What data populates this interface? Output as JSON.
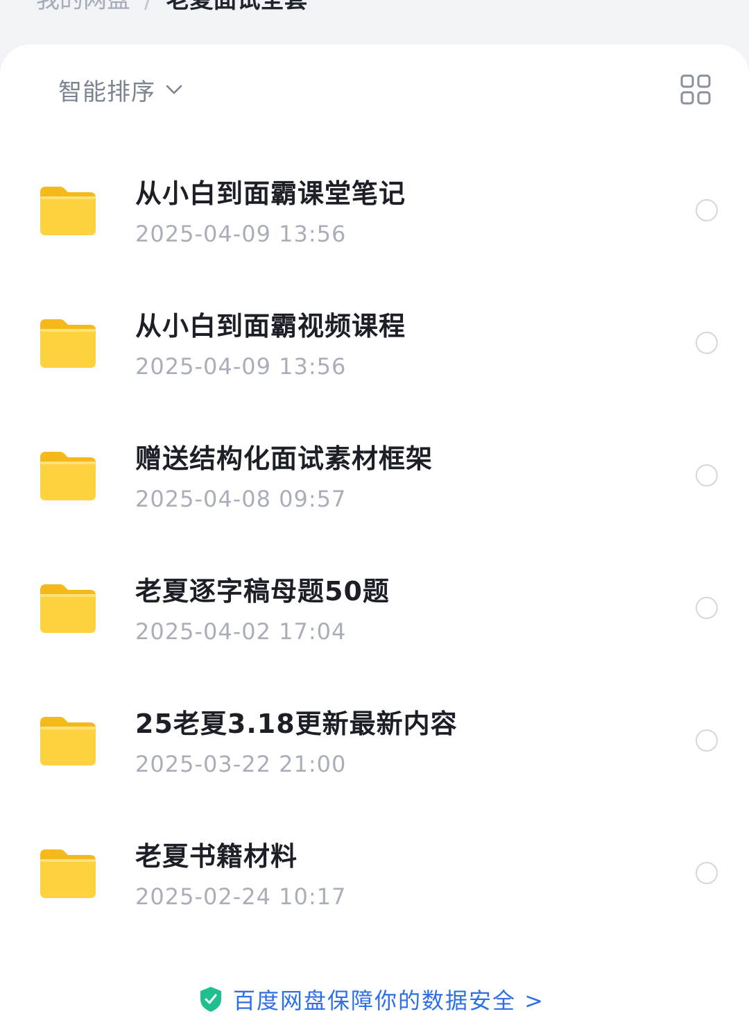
{
  "breadcrumb": {
    "root": "我的网盘",
    "separator": "/",
    "current": "老夏面试全套"
  },
  "toolbar": {
    "sort_label": "智能排序",
    "sort_icon": "chevron-down-icon",
    "view_toggle_icon": "grid-view-icon"
  },
  "files": [
    {
      "name": "从小白到面霸课堂笔记",
      "date": "2025-04-09 13:56",
      "type": "folder"
    },
    {
      "name": "从小白到面霸视频课程",
      "date": "2025-04-09 13:56",
      "type": "folder"
    },
    {
      "name": "赠送结构化面试素材框架",
      "date": "2025-04-08 09:57",
      "type": "folder"
    },
    {
      "name": "老夏逐字稿母题50题",
      "date": "2025-04-02 17:04",
      "type": "folder"
    },
    {
      "name": "25老夏3.18更新最新内容",
      "date": "2025-03-22 21:00",
      "type": "folder"
    },
    {
      "name": "老夏书籍材料",
      "date": "2025-02-24 10:17",
      "type": "folder"
    }
  ],
  "footer": {
    "notice": "百度网盘保障你的数据安全 >",
    "icon": "shield-icon"
  },
  "colors": {
    "folder": "#ffd23f",
    "accent": "#2f6fe4",
    "text_primary": "#1c1f26",
    "text_secondary": "#a9aeb8"
  }
}
